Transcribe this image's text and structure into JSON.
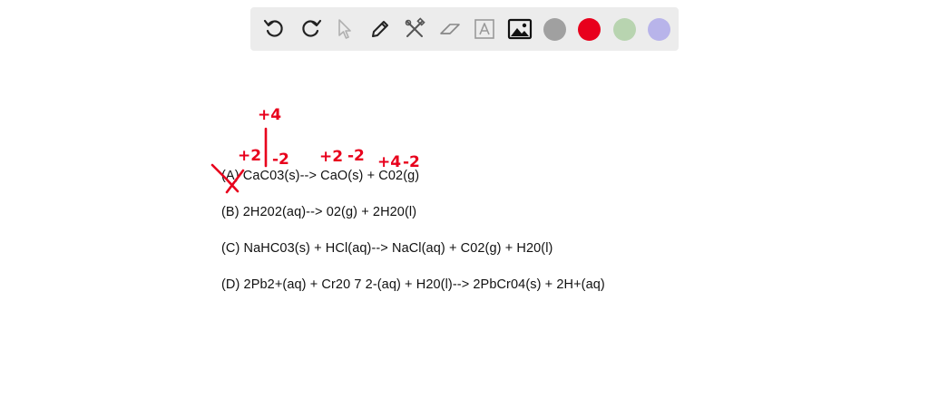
{
  "toolbar": {
    "tools": [
      {
        "name": "undo-icon"
      },
      {
        "name": "redo-icon"
      },
      {
        "name": "pointer-icon"
      },
      {
        "name": "pen-icon"
      },
      {
        "name": "tools-icon"
      },
      {
        "name": "eraser-icon"
      },
      {
        "name": "text-icon"
      },
      {
        "name": "image-icon"
      }
    ],
    "colors": [
      "#a0a0a0",
      "#e8001c",
      "#b8d4b0",
      "#b8b4ea"
    ]
  },
  "equations": [
    "(A) CaC03(s)--> CaO(s) + C02(g)",
    "(B) 2H202(aq)--> 02(g) + 2H20(l)",
    "(C) NaHC03(s) + HCl(aq)--> NaCl(aq) + C02(g) + H20(l)",
    "(D) 2Pb2+(aq) + Cr20 7 2-(aq) + H20(l)--> 2PbCr04(s) + 2H+(aq)"
  ],
  "annotations": [
    "+4",
    "+2",
    "-2",
    "+2",
    "-2",
    "+4",
    "-2"
  ],
  "ink_color": "#e8001c"
}
